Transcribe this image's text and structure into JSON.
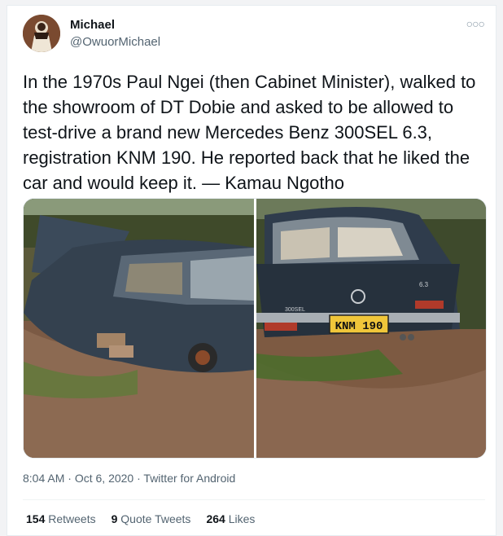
{
  "user": {
    "name": "Michael",
    "handle": "@OwuorMichael"
  },
  "tweet": {
    "text": "In the 1970s Paul Ngei (then Cabinet Minister), walked to the showroom of DT Dobie and asked to be allowed to test-drive a brand new Mercedes Benz 300SEL 6.3, registration KNM 190. He reported back that he liked the car and would keep it. — Kamau Ngotho"
  },
  "media": {
    "photos": [
      {
        "description": "old-car-side-view"
      },
      {
        "description": "old-car-rear-view",
        "plate_text": "KNM 190",
        "badge_left": "300SEL",
        "badge_right": "6.3"
      }
    ]
  },
  "meta": {
    "time": "8:04 AM",
    "date": "Oct 6, 2020",
    "separator": "·",
    "source": "Twitter for Android"
  },
  "stats": {
    "retweets": {
      "count": "154",
      "label": "Retweets"
    },
    "quote_tweets": {
      "count": "9",
      "label": "Quote Tweets"
    },
    "likes": {
      "count": "264",
      "label": "Likes"
    }
  },
  "colors": {
    "text_primary": "#0f1419",
    "text_secondary": "#536471",
    "border": "#e6ecf0"
  },
  "icons": {
    "more": "more-horizontal-icon"
  }
}
